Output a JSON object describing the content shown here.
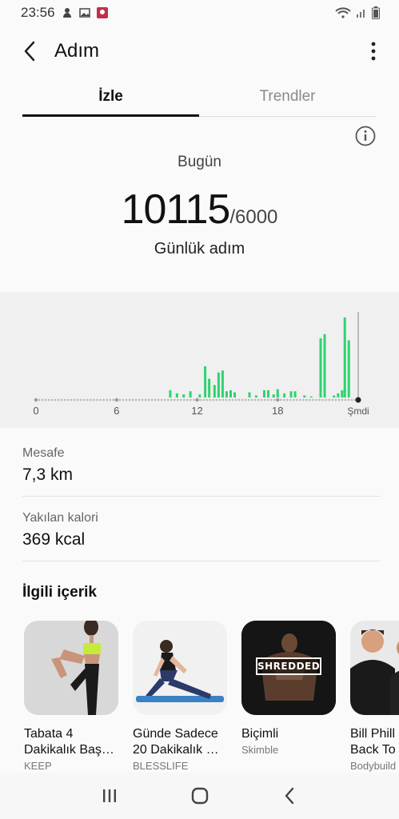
{
  "status_bar": {
    "time": "23:56"
  },
  "header": {
    "title": "Adım"
  },
  "tabs": [
    {
      "label": "İzle",
      "active": true
    },
    {
      "label": "Trendler",
      "active": false
    }
  ],
  "summary": {
    "period_label": "Bugün",
    "steps": "10115",
    "goal": "/6000",
    "caption": "Günlük adım"
  },
  "chart_data": {
    "type": "bar",
    "x_ticks": [
      "0",
      "6",
      "12",
      "18",
      "Şmdi"
    ],
    "series": [
      {
        "values": [
          [
            10,
            0.07
          ],
          [
            10.5,
            0.04
          ],
          [
            11,
            0.03
          ],
          [
            11.5,
            0.06
          ],
          [
            12.2,
            0.03
          ],
          [
            12.6,
            0.3
          ],
          [
            12.9,
            0.18
          ],
          [
            13.3,
            0.12
          ],
          [
            13.6,
            0.24
          ],
          [
            13.9,
            0.26
          ],
          [
            14.2,
            0.06
          ],
          [
            14.5,
            0.07
          ],
          [
            14.8,
            0.05
          ],
          [
            15.9,
            0.05
          ],
          [
            16.4,
            0.02
          ],
          [
            17.0,
            0.07
          ],
          [
            17.3,
            0.07
          ],
          [
            17.7,
            0.03
          ],
          [
            18.0,
            0.08
          ],
          [
            18.5,
            0.04
          ],
          [
            19.0,
            0.06
          ],
          [
            19.3,
            0.06
          ],
          [
            20.0,
            0.02
          ],
          [
            20.5,
            0.01
          ],
          [
            21.2,
            0.57
          ],
          [
            21.5,
            0.61
          ],
          [
            22.2,
            0.02
          ],
          [
            22.5,
            0.04
          ],
          [
            22.8,
            0.07
          ],
          [
            23.0,
            0.77
          ],
          [
            23.3,
            0.55
          ]
        ]
      }
    ],
    "colors": {
      "bar": "#2fd36f",
      "axis_dot": "#b7b7b7"
    },
    "grid": false
  },
  "metrics": [
    {
      "label": "Mesafe",
      "value": "7,3 km"
    },
    {
      "label": "Yakılan kalori",
      "value": "369 kcal"
    }
  ],
  "related": {
    "title": "İlgili içerik",
    "items": [
      {
        "name": "Tabata 4 Dakikalık Baş…",
        "line1": "Tabata 4",
        "line2": "Dakikalık Baş…",
        "publisher": "KEEP"
      },
      {
        "name": "Günde Sadece 20 Dakikalık …",
        "line1": "Günde Sadece",
        "line2": "20 Dakikalık …",
        "publisher": "BLESSLIFE"
      },
      {
        "name": "Biçimli",
        "line1": "Biçimli",
        "line2": "",
        "publisher": "Skimble",
        "badge": "SHREDDED"
      },
      {
        "name": "Bill Phill Back To",
        "line1": "Bill Phill",
        "line2": "Back To",
        "publisher": "Bodybuild"
      }
    ]
  },
  "icons": {
    "back": "back-arrow-icon",
    "more": "more-vert-icon",
    "info": "info-icon"
  }
}
